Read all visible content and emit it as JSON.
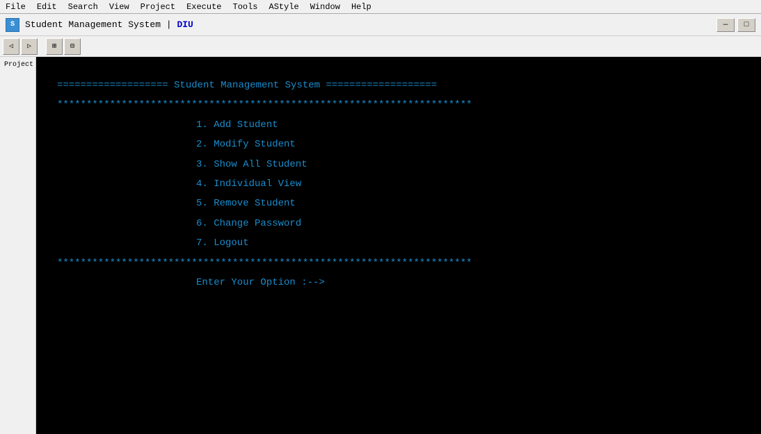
{
  "window": {
    "title": "Student Management System",
    "title_separator": " | ",
    "title_suffix": "DIU",
    "minimize_btn": "—",
    "maximize_btn": "□"
  },
  "menu": {
    "items": [
      "File",
      "Edit",
      "Search",
      "View",
      "Project",
      "Execute",
      "Tools",
      "AStyle",
      "Window",
      "Help"
    ]
  },
  "sidebar": {
    "label": "Project"
  },
  "terminal": {
    "header_equals": "=================== Student Management System ===================",
    "stars_top": "***********************************************************************",
    "menu_items": [
      "1. Add Student",
      "2. Modify Student",
      "3. Show All Student",
      "4. Individual View",
      "5. Remove Student",
      "6. Change Password",
      "7. Logout"
    ],
    "stars_bottom": "***********************************************************************",
    "prompt": "Enter Your Option :-->"
  }
}
